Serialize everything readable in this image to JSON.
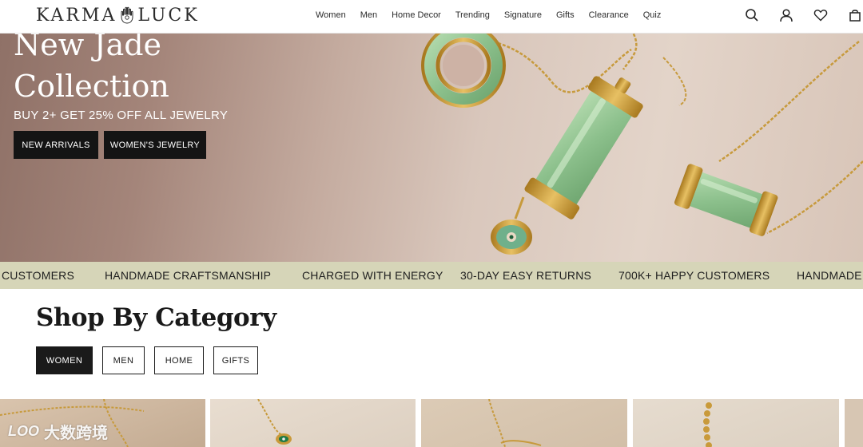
{
  "header": {
    "brand_left": "KARMA",
    "brand_right": "LUCK",
    "nav": [
      "Women",
      "Men",
      "Home Decor",
      "Trending",
      "Signature",
      "Gifts",
      "Clearance",
      "Quiz"
    ],
    "icons": [
      "search-icon",
      "account-icon",
      "wishlist-heart-icon",
      "cart-bag-icon"
    ]
  },
  "hero": {
    "title_line1": "New Jade",
    "title_line2": "Collection",
    "promo": "BUY 2+ GET 25% OFF ALL JEWELRY",
    "btn_new_arrivals": "NEW ARRIVALS",
    "btn_womens_jewelry": "WOMEN'S JEWELRY"
  },
  "marquee": {
    "items": [
      "CUSTOMERS",
      "HANDMADE CRAFTSMANSHIP",
      "CHARGED WITH ENERGY",
      "30-DAY EASY RETURNS",
      "700K+ HAPPY CUSTOMERS",
      "HANDMADE"
    ]
  },
  "category": {
    "title": "Shop By Category",
    "tabs": [
      "WOMEN",
      "MEN",
      "HOME",
      "GIFTS"
    ],
    "active_tab": "WOMEN"
  },
  "watermark": {
    "logo": "LOO",
    "text": "大数跨境"
  },
  "colors": {
    "marquee_bg": "#d6d5b8",
    "button_dark": "#141414",
    "jade": "#8fc28f",
    "gold": "#c99a3a"
  }
}
